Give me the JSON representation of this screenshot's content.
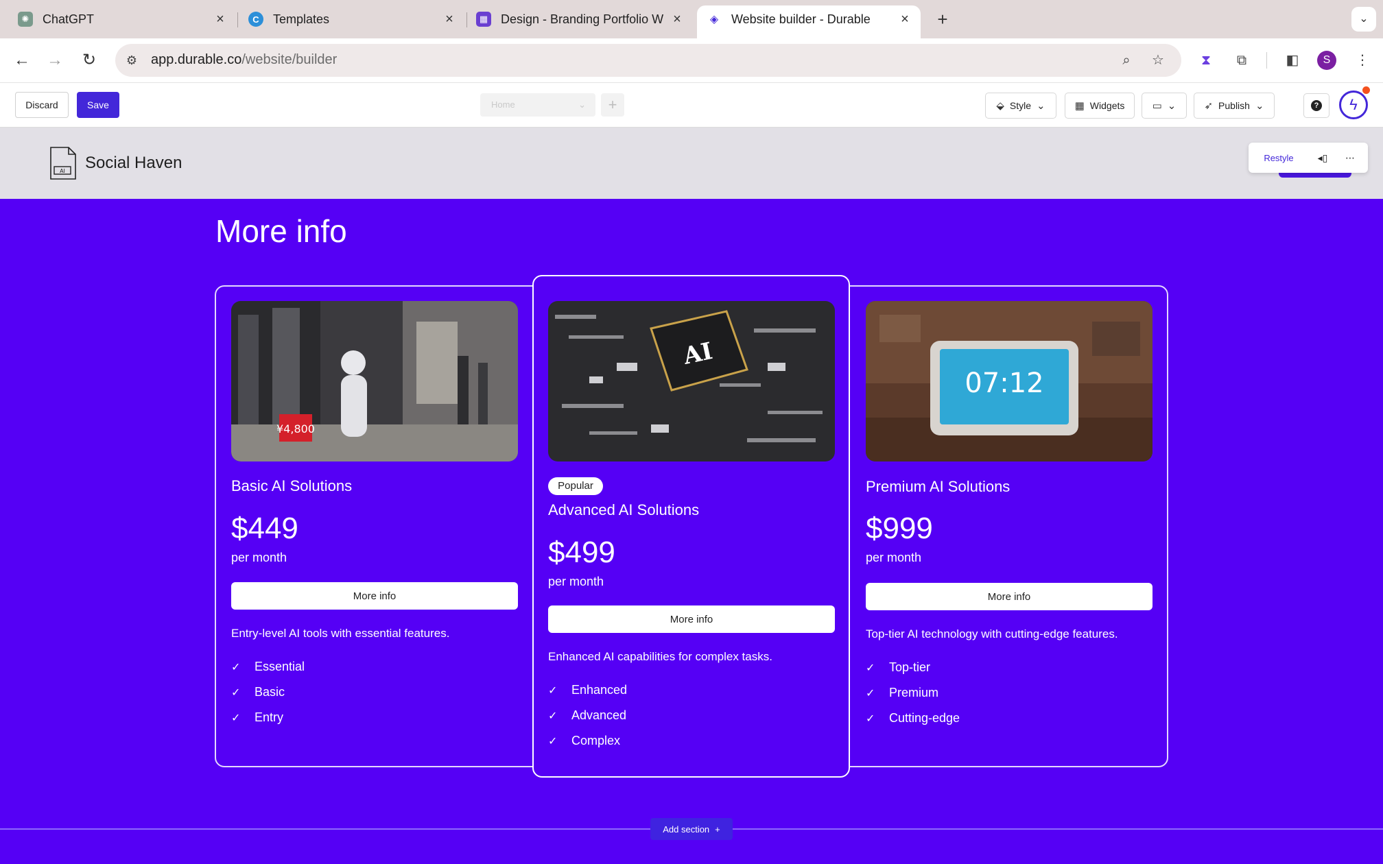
{
  "browser": {
    "tabs": [
      {
        "label": "ChatGPT",
        "active": false
      },
      {
        "label": "Templates",
        "active": false
      },
      {
        "label": "Design - Branding Portfolio W",
        "active": false
      },
      {
        "label": "Website builder - Durable",
        "active": true
      }
    ],
    "url_host": "app.durable.co",
    "url_path": "/website/builder",
    "profile_initial": "S"
  },
  "editor": {
    "discard_label": "Discard",
    "save_label": "Save",
    "page_select": "Home",
    "style_label": "Style",
    "widgets_label": "Widgets",
    "publish_label": "Publish"
  },
  "site": {
    "name": "Social Haven",
    "logo_text": "AI",
    "restyle_label": "Restyle"
  },
  "section": {
    "title": "More info",
    "popular_badge": "Popular",
    "cards": [
      {
        "title": "Basic AI Solutions",
        "price": "$449",
        "period": "per month",
        "cta": "More info",
        "description": "Entry-level AI tools with essential features.",
        "features": [
          "Essential",
          "Basic",
          "Entry"
        ],
        "image_text": "¥4,800"
      },
      {
        "title": "Advanced AI Solutions",
        "price": "$499",
        "period": "per month",
        "cta": "More info",
        "description": "Enhanced AI capabilities for complex tasks.",
        "features": [
          "Enhanced",
          "Advanced",
          "Complex"
        ],
        "image_text": "AI"
      },
      {
        "title": "Premium AI Solutions",
        "price": "$999",
        "period": "per month",
        "cta": "More info",
        "description": "Top-tier AI technology with cutting-edge features.",
        "features": [
          "Top-tier",
          "Premium",
          "Cutting-edge"
        ],
        "image_text": "07:12"
      }
    ],
    "add_section_label": "Add section"
  },
  "colors": {
    "section_bg": "#5500f5",
    "accent": "#4327d9",
    "tabstrip": "#e2d9d9"
  }
}
